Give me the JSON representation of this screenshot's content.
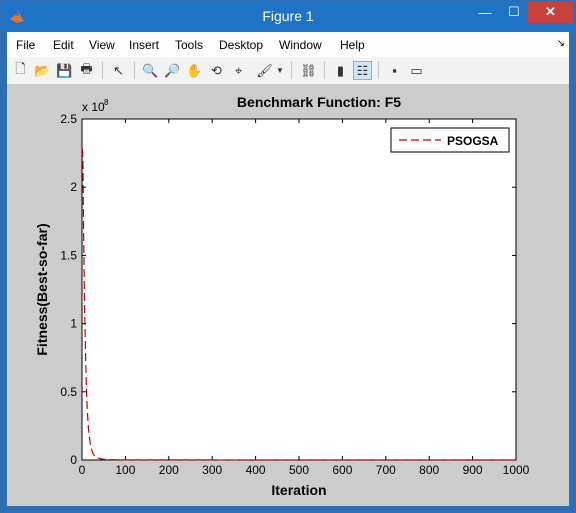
{
  "window": {
    "title": "Figure 1",
    "app_icon": "matlab-icon",
    "controls": {
      "minimize": "—",
      "maximize": "☐",
      "close": "✕"
    }
  },
  "menubar": {
    "items": [
      "File",
      "Edit",
      "View",
      "Insert",
      "Tools",
      "Desktop",
      "Window",
      "Help"
    ],
    "dock_arrow": "↘"
  },
  "toolbar": {
    "buttons": [
      {
        "name": "new-figure-icon",
        "glyph": "🗋"
      },
      {
        "name": "open-file-icon",
        "glyph": "📂"
      },
      {
        "name": "save-icon",
        "glyph": "💾"
      },
      {
        "name": "print-icon",
        "glyph": "🖶"
      },
      {
        "name": "edit-plot-arrow-icon",
        "glyph": "↖"
      },
      {
        "name": "zoom-in-icon",
        "glyph": "🔍"
      },
      {
        "name": "zoom-out-icon",
        "glyph": "🔎"
      },
      {
        "name": "pan-hand-icon",
        "glyph": "✋"
      },
      {
        "name": "rotate-3d-icon",
        "glyph": "⟲"
      },
      {
        "name": "data-cursor-icon",
        "glyph": "⌖"
      },
      {
        "name": "brush-icon",
        "glyph": "🖌"
      },
      {
        "name": "link-plot-icon",
        "glyph": "⛓"
      },
      {
        "name": "insert-colorbar-icon",
        "glyph": "▮"
      },
      {
        "name": "insert-legend-icon",
        "glyph": "☷"
      },
      {
        "name": "hide-plot-tools-icon",
        "glyph": "▪"
      },
      {
        "name": "show-plot-tools-icon",
        "glyph": "▭"
      }
    ]
  },
  "colors": {
    "figure_bg": "#cccccc",
    "axes_bg": "#ffffff",
    "series_color": "#c00000",
    "active_tool": "#cfe6f8"
  },
  "chart_data": {
    "type": "line",
    "title": "Benchmark Function: F5",
    "xlabel": "Iteration",
    "ylabel": "Fitness(Best-so-far)",
    "y_exponent_label": "x 10",
    "y_exponent_power": "8",
    "xlim": [
      0,
      1000
    ],
    "ylim": [
      0,
      2.5
    ],
    "y_scale_factor": 100000000,
    "xticks": [
      0,
      100,
      200,
      300,
      400,
      500,
      600,
      700,
      800,
      900,
      1000
    ],
    "yticks": [
      0,
      0.5,
      1,
      1.5,
      2,
      2.5
    ],
    "ytick_labels": [
      "0",
      "0.5",
      "1",
      "1.5",
      "2",
      "2.5"
    ],
    "legend": {
      "position": "top-right",
      "entries": [
        "PSOGSA"
      ]
    },
    "grid": false,
    "series": [
      {
        "name": "PSOGSA",
        "line_style": "dashed",
        "x": [
          1,
          2,
          3,
          4,
          5,
          6,
          8,
          10,
          12,
          15,
          20,
          25,
          30,
          40,
          50,
          70,
          100,
          200,
          300,
          400,
          500,
          600,
          700,
          800,
          900,
          1000
        ],
        "y": [
          2.28,
          2.2,
          1.9,
          1.6,
          1.35,
          1.1,
          0.8,
          0.55,
          0.38,
          0.22,
          0.1,
          0.05,
          0.025,
          0.01,
          0.005,
          0.002,
          0.001,
          0.0005,
          0.0004,
          0.0003,
          0.0003,
          0.0002,
          0.0002,
          0.0002,
          0.0002,
          0.0002
        ]
      }
    ]
  }
}
